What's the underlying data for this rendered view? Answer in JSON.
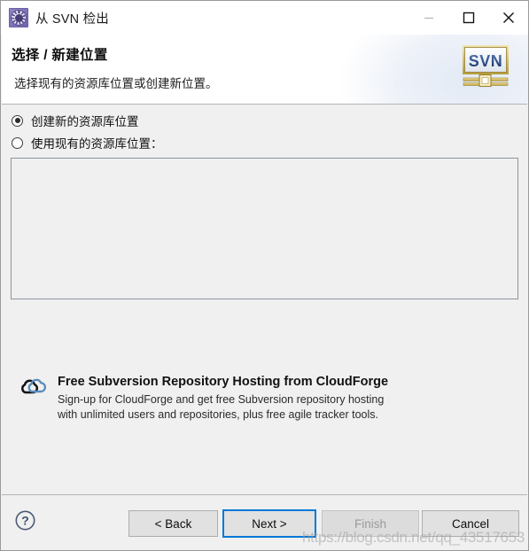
{
  "window": {
    "title": "从 SVN 检出",
    "icon": "svn-gear-icon",
    "controls": {
      "minimize": "minimize-icon",
      "maximize": "maximize-icon",
      "close": "close-icon"
    }
  },
  "header": {
    "title": "选择 / 新建位置",
    "subtitle": "选择现有的资源库位置或创建新位置。",
    "logo_text": "SVN",
    "logo_name": "svn-banner-logo"
  },
  "body": {
    "radios": [
      {
        "label": "创建新的资源库位置",
        "checked": true
      },
      {
        "label": "使用现有的资源库位置：",
        "checked": false
      }
    ],
    "repository_list": {
      "items": [],
      "empty": true
    }
  },
  "promo": {
    "icon": "cloudforge-cloud-icon",
    "title": "Free Subversion Repository Hosting from CloudForge",
    "line1": "Sign-up for CloudForge and get free Subversion repository hosting",
    "line2": "with unlimited users and repositories, plus free agile tracker tools."
  },
  "footer": {
    "help_icon": "help-question-icon",
    "buttons": {
      "back": {
        "label": "< Back",
        "enabled": true,
        "focused": false
      },
      "next": {
        "label": "Next >",
        "enabled": true,
        "focused": true
      },
      "finish": {
        "label": "Finish",
        "enabled": false,
        "focused": false
      },
      "cancel": {
        "label": "Cancel",
        "enabled": true,
        "focused": false
      }
    }
  },
  "watermark": {
    "text": "https://blog.csdn.net/qq_43517653"
  },
  "colors": {
    "focus_blue": "#0078d7",
    "dialog_bg": "#f0f0f0",
    "header_bg": "#ffffff",
    "border": "#b4b4b4",
    "disabled_text": "#9a9a9a",
    "cloud_blue": "#5a8cbd",
    "title_icon_purple": "#7d74b8"
  }
}
